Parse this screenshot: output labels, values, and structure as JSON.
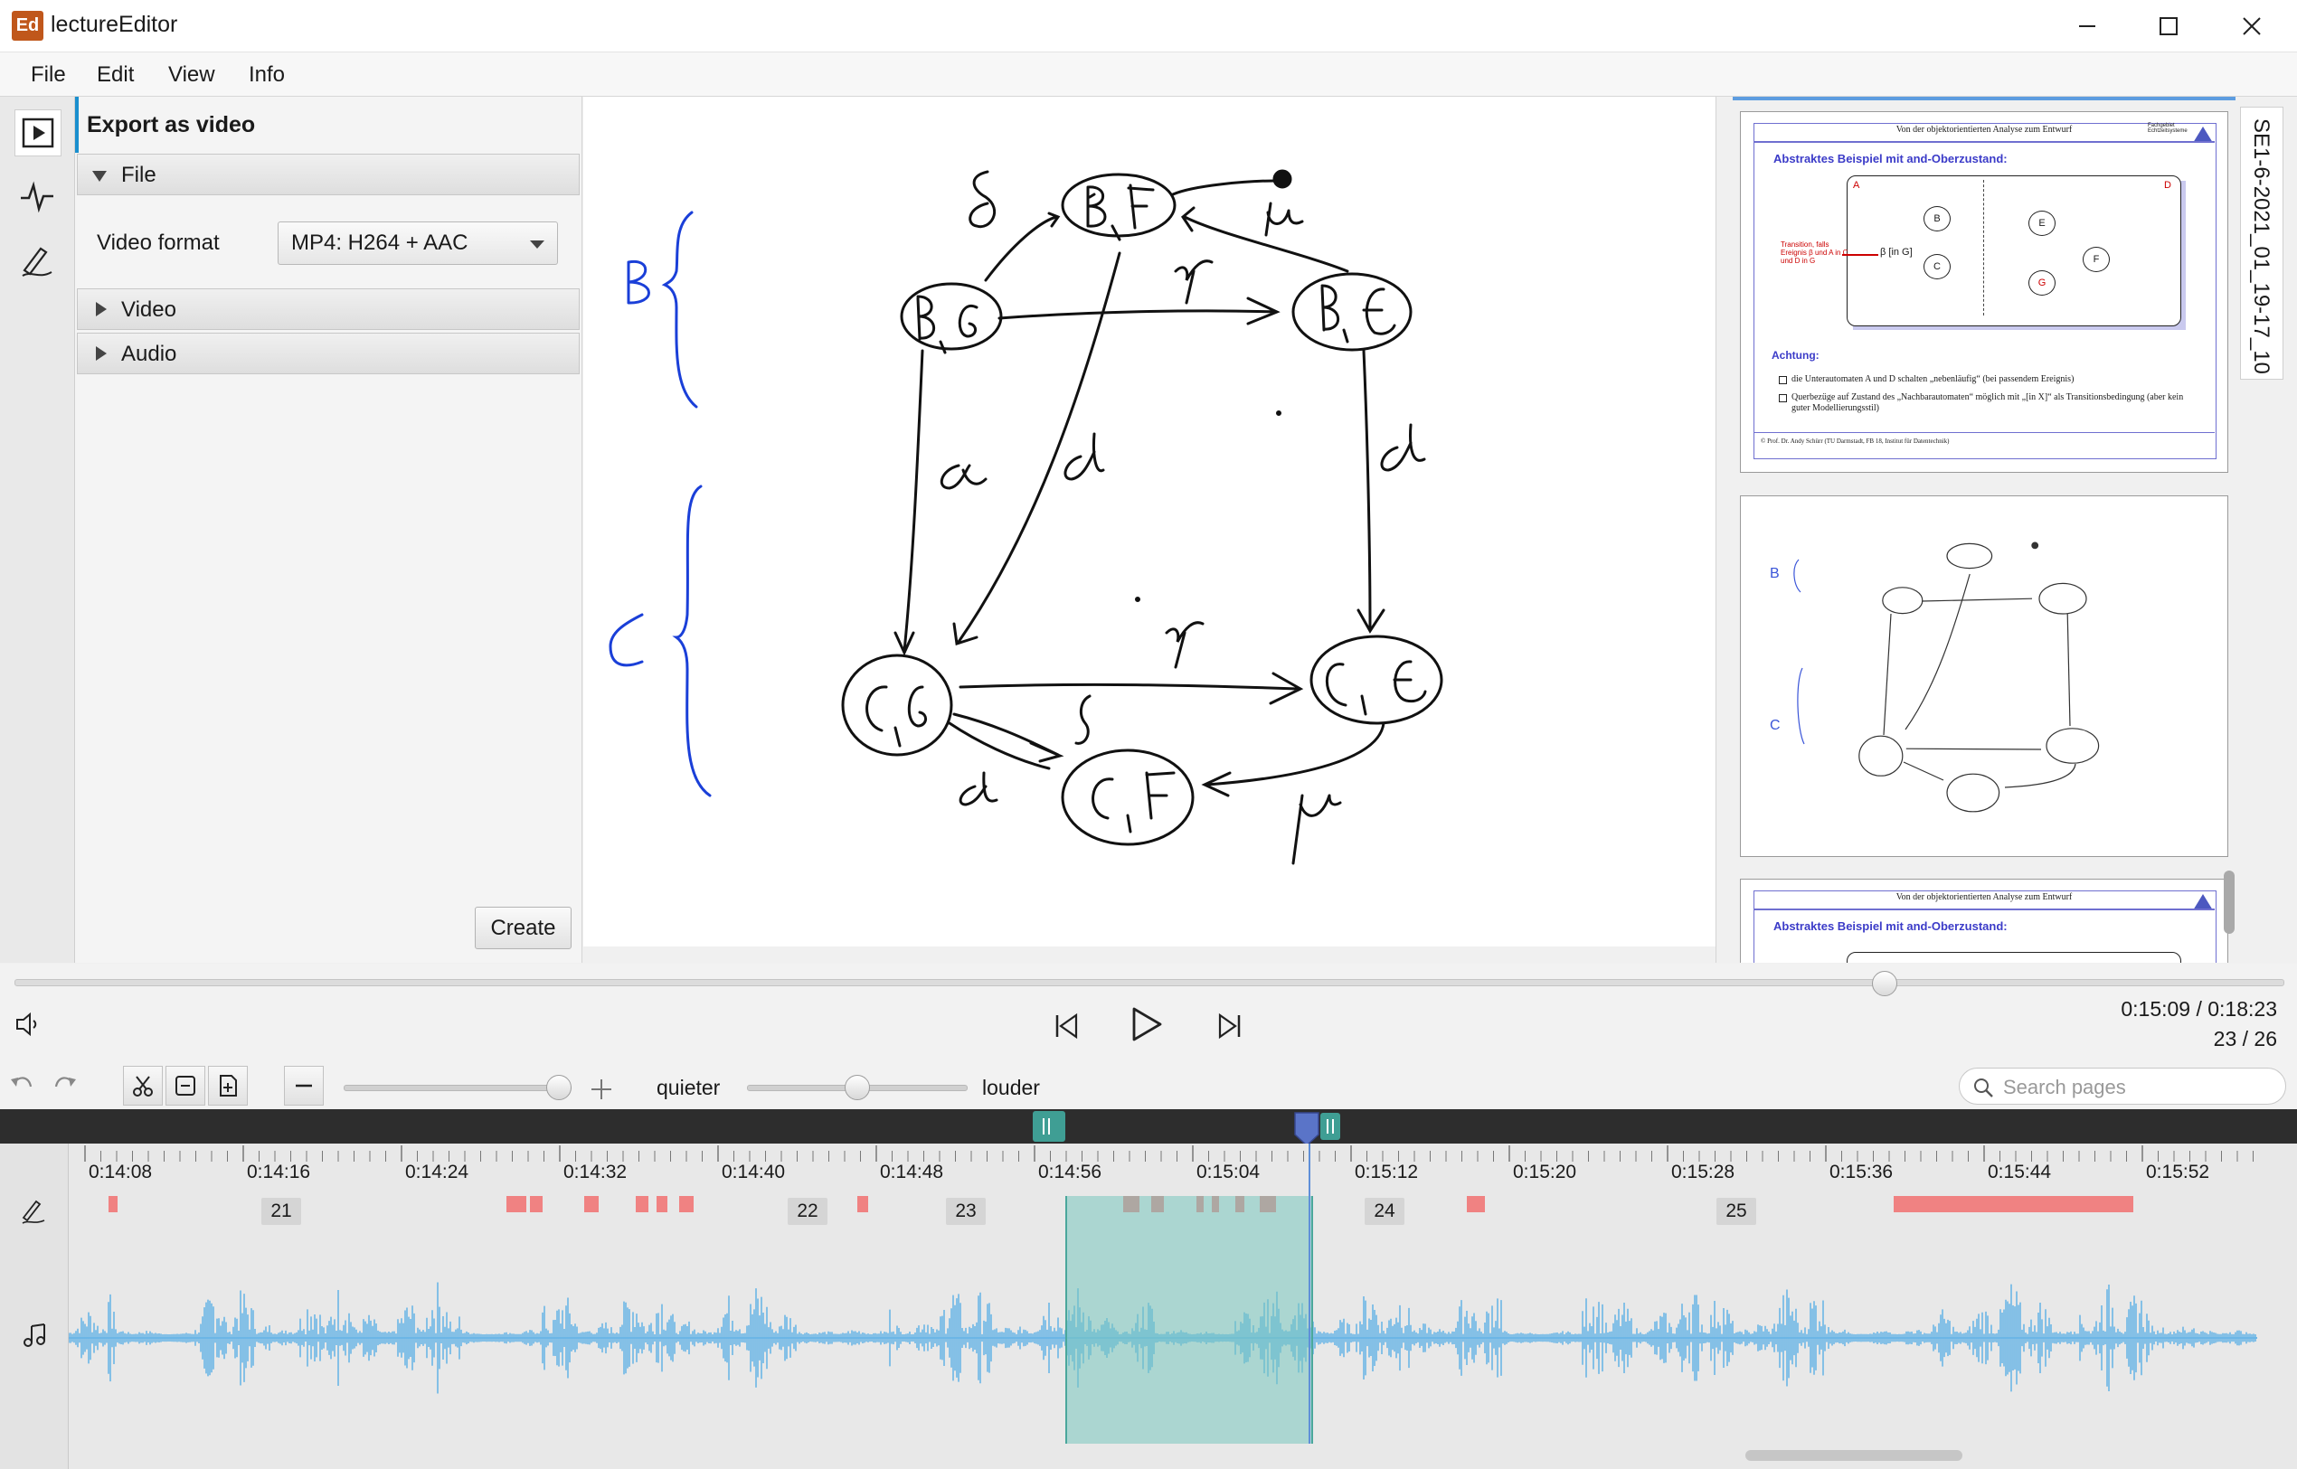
{
  "window": {
    "title": "lectureEditor",
    "logo_text": "Ed",
    "buttons": [
      "minimize-icon",
      "maximize-icon",
      "close-icon"
    ]
  },
  "menu": {
    "items": [
      "File",
      "Edit",
      "View",
      "Info"
    ]
  },
  "left_toolbar": {
    "icons": [
      "play-video-icon",
      "audio-waveform-icon",
      "pen-annotation-icon"
    ]
  },
  "export_panel": {
    "title": "Export as video",
    "sections": {
      "file": "File",
      "video": "Video",
      "audio": "Audio"
    },
    "video_format_label": "Video format",
    "video_format_value": "MP4: H264 + AAC",
    "create_label": "Create"
  },
  "right_panel": {
    "vertical_tab": "SE1-6-2021_01_19-17_10",
    "slide_header": "Von der objektorientierten Analyse zum Entwurf",
    "slide_heading": "Abstraktes Beispiel mit and-Oberzustand:",
    "slide_logo": "Fachgebiet Echtzeitsysteme",
    "transition_note": "Transition, falls Ereignis β und A in C und D in G",
    "attention": "Achtung:",
    "bullet_1": "die Unterautomaten A und D schalten „nebenläufig“ (bei passendem Ereignis)",
    "bullet_2": "Querbezüge auf Zustand des „Nachbarautomaten“ möglich mit „[in X]“ als Transitionsbedingung (aber kein guter Modellierungsstil)",
    "footer": "© Prof. Dr. Andy Schürr (TU Darmstadt, FB 18, Institut für Datentechnik)",
    "diagram_labels": [
      "A",
      "B",
      "C",
      "D",
      "E",
      "F",
      "G",
      "β [in G]"
    ]
  },
  "playback": {
    "time": "0:15:09 / 0:18:23",
    "page": "23 / 26",
    "seek_fraction": 0.824,
    "icons": [
      "volume-icon",
      "skip-previous-icon",
      "play-icon",
      "skip-next-icon"
    ]
  },
  "edit_toolbar": {
    "icons": [
      "undo-icon",
      "redo-icon",
      "cut-icon",
      "delete-selection-icon",
      "insert-page-icon",
      "zoom-out-icon",
      "zoom-in-icon"
    ],
    "zoom_fraction": 1.0,
    "quieter_label": "quieter",
    "louder_label": "louder",
    "volume_fraction": 0.5,
    "search_placeholder": "Search pages"
  },
  "timeline": {
    "ticks": [
      "0:14:08",
      "0:14:16",
      "0:14:24",
      "0:14:32",
      "0:14:40",
      "0:14:48",
      "0:14:56",
      "0:15:04",
      "0:15:12",
      "0:15:20",
      "0:15:28",
      "0:15:36",
      "0:15:44",
      "0:15:52"
    ],
    "pages": [
      "21",
      "22",
      "23",
      "24",
      "25"
    ],
    "track_icons": [
      "pen-track-icon",
      "music-note-icon"
    ],
    "colors": {
      "waveform": "#6cb6e6",
      "annotation_events": "#f08282",
      "selection": "#78c6be",
      "marker": "#5a74c8"
    }
  }
}
